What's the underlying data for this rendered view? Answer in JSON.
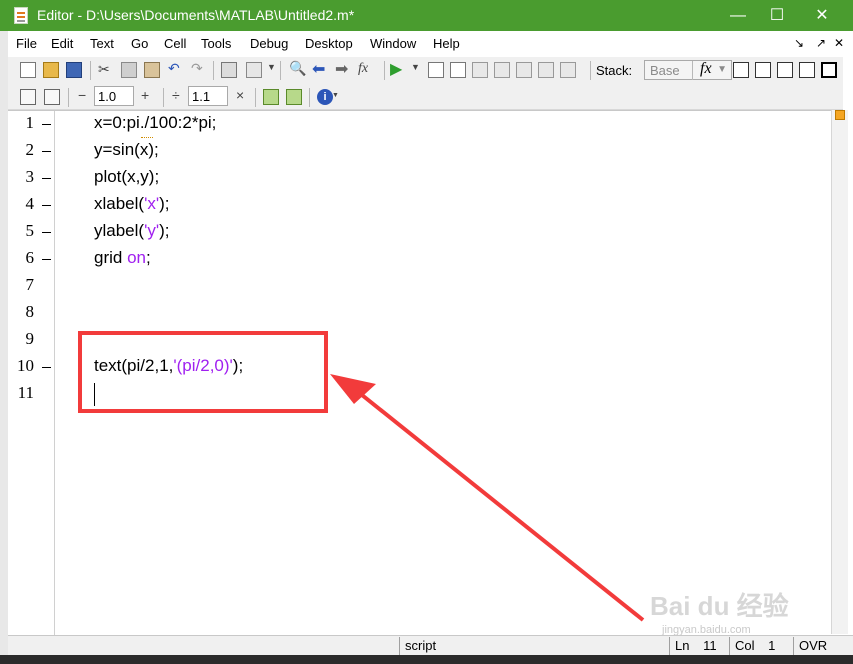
{
  "window": {
    "title": "Editor - D:\\Users\\Documents\\MATLAB\\Untitled2.m*",
    "minimize": "—",
    "maximize": "☐",
    "close": "✕"
  },
  "menu": [
    "File",
    "Edit",
    "Text",
    "Go",
    "Cell",
    "Tools",
    "Debug",
    "Desktop",
    "Window",
    "Help"
  ],
  "menu_dock": [
    "↘",
    "↗",
    "✕"
  ],
  "toolbar": {
    "stack_label": "Stack:",
    "stack_value": "Base",
    "fx_label": "fx",
    "fx_small": "fx",
    "icons": [
      "new-file-icon",
      "open-folder-icon",
      "save-icon",
      "cut-icon",
      "copy-icon",
      "paste-icon",
      "undo-icon",
      "redo-icon",
      "print-icon",
      "find-icon",
      "back-icon",
      "forward-icon",
      "run-icon",
      "breakpoint-icon",
      "clear-breakpoints-icon",
      "step-icon",
      "step-in-icon",
      "step-out-icon",
      "continue-icon",
      "exit-debug-icon"
    ]
  },
  "cell_toolbar": {
    "minus": "−",
    "value1": "1.0",
    "plus": "+",
    "divide": "÷",
    "value2": "1.1",
    "times": "×",
    "info": "i"
  },
  "editor": {
    "lines": [
      {
        "n": "1",
        "marker": true,
        "segments": [
          {
            "text": "x=0:pi./100:2*pi;",
            "cls": ""
          }
        ]
      },
      {
        "n": "2",
        "marker": true,
        "segments": [
          {
            "text": "y=sin(x);",
            "cls": ""
          }
        ]
      },
      {
        "n": "3",
        "marker": true,
        "segments": [
          {
            "text": "plot(x,y);",
            "cls": ""
          }
        ]
      },
      {
        "n": "4",
        "marker": true,
        "segments": [
          {
            "text": "xlabel(",
            "cls": ""
          },
          {
            "text": "'x'",
            "cls": "str"
          },
          {
            "text": ");",
            "cls": ""
          }
        ]
      },
      {
        "n": "5",
        "marker": true,
        "segments": [
          {
            "text": "ylabel(",
            "cls": ""
          },
          {
            "text": "'y'",
            "cls": "str"
          },
          {
            "text": ");",
            "cls": ""
          }
        ]
      },
      {
        "n": "6",
        "marker": true,
        "segments": [
          {
            "text": "grid ",
            "cls": ""
          },
          {
            "text": "on",
            "cls": "kw"
          },
          {
            "text": ";",
            "cls": ""
          }
        ]
      },
      {
        "n": "7",
        "marker": false,
        "segments": []
      },
      {
        "n": "8",
        "marker": false,
        "segments": []
      },
      {
        "n": "9",
        "marker": false,
        "segments": []
      },
      {
        "n": "10",
        "marker": true,
        "segments": [
          {
            "text": "text(pi/2,1,",
            "cls": ""
          },
          {
            "text": "'(pi/2,0)'",
            "cls": "str"
          },
          {
            "text": ");",
            "cls": ""
          }
        ]
      },
      {
        "n": "11",
        "marker": false,
        "segments": []
      }
    ]
  },
  "status": {
    "mode": "script",
    "ln_label": "Ln",
    "ln_value": "11",
    "col_label": "Col",
    "col_value": "1",
    "ovr": "OVR"
  },
  "annotation": {
    "color": "#f23b3b"
  },
  "watermark": {
    "text": "Bai du 经验",
    "sub": "jingyan.baidu.com"
  },
  "colors": {
    "titlebar": "#4a9c2f",
    "string": "#a020f0",
    "keyword": "#a020f0"
  }
}
